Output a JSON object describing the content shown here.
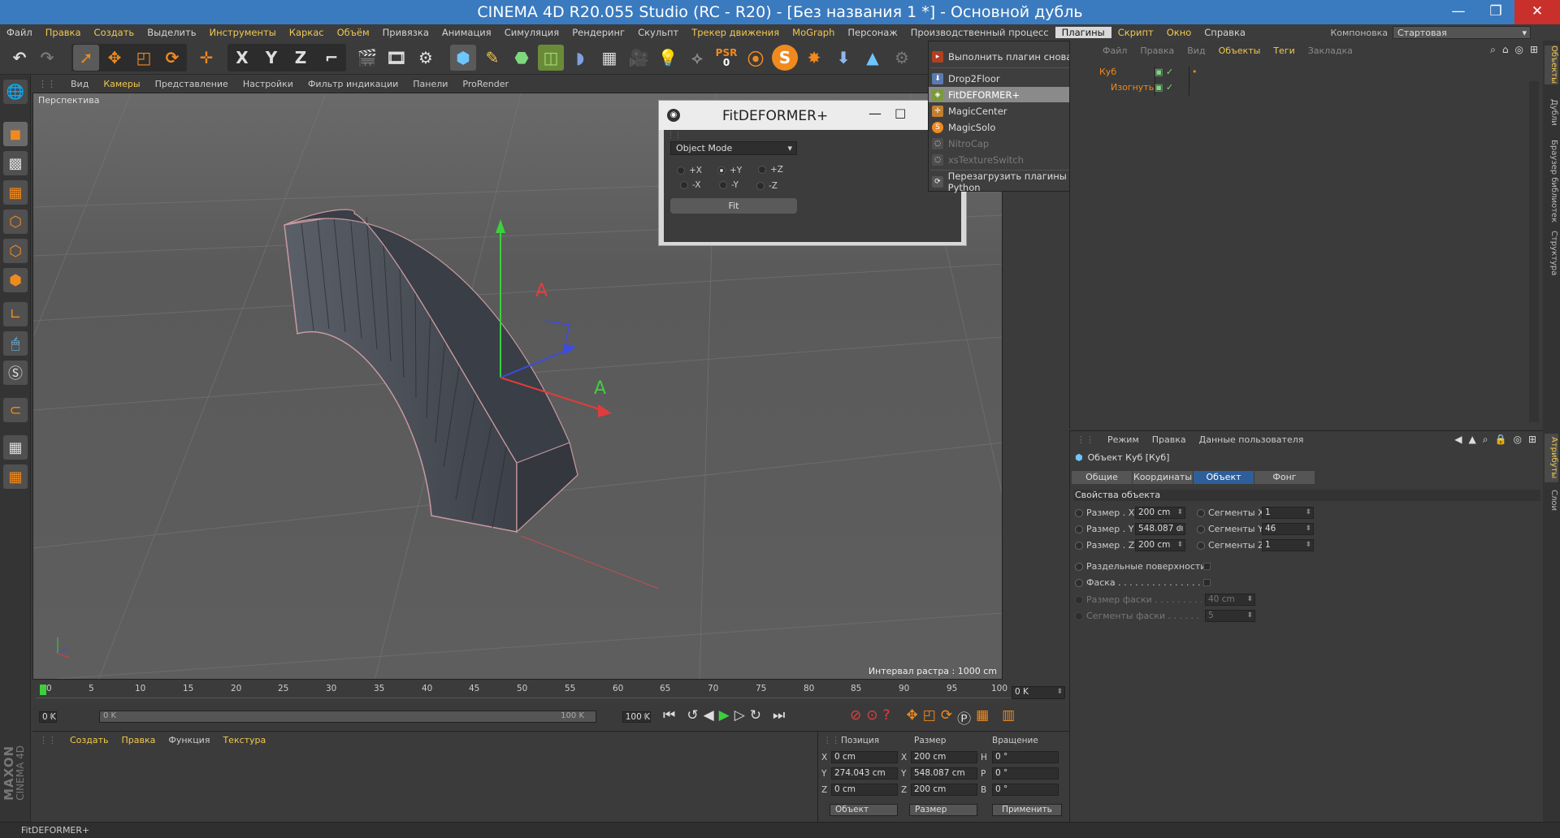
{
  "window": {
    "title": "CINEMA 4D R20.055 Studio (RC - R20) - [Без названия 1 *] - Основной дубль",
    "minimize": "—",
    "maximize": "❐",
    "close": "✕"
  },
  "menu": {
    "items": [
      "Файл",
      "Правка",
      "Создать",
      "Выделить",
      "Инструменты",
      "Каркас",
      "Объём",
      "Привязка",
      "Анимация",
      "Симуляция",
      "Рендеринг",
      "Скульпт",
      "Трекер движения",
      "MoGraph",
      "Персонаж",
      "Производственный процесс",
      "Плагины",
      "Скрипт",
      "Окно",
      "Справка"
    ],
    "layout_label": "Компоновка",
    "layout_value": "Стартовая (пользователь)"
  },
  "toolbar": {
    "x": "X",
    "y": "Y",
    "z": "Z",
    "psr": "PSR",
    "psr_value": "0",
    "s": "S"
  },
  "viewport": {
    "menu": [
      "Вид",
      "Камеры",
      "Представление",
      "Настройки",
      "Фильтр индикации",
      "Панели",
      "ProRender"
    ],
    "label": "Перспектива",
    "grid_info": "Интервал растра : 1000 cm"
  },
  "fitdeformer": {
    "title": "FitDEFORMER+",
    "mode": "Object Mode",
    "radios": [
      "+X",
      "+Y",
      "+Z",
      "-X",
      "-Y",
      "-Z"
    ],
    "fit_label": "Fit"
  },
  "plugins_menu": {
    "items": [
      "Выполнить плагин снова",
      "Drop2Floor",
      "FitDEFORMER+",
      "MagicCenter",
      "MagicSolo",
      "NitroCap",
      "xsTextureSwitch",
      "Перезагрузить плагины Python"
    ]
  },
  "object_manager": {
    "menu": [
      "Файл",
      "Правка",
      "Вид",
      "Объекты",
      "Теги",
      "Закладка"
    ],
    "objects": [
      "Куб",
      "Изогнуть"
    ]
  },
  "right_tabs": [
    "Объекты",
    "Дубли",
    "Браузер библиотек",
    "Структура",
    "Атрибуты",
    "Слои"
  ],
  "attributes": {
    "menu": [
      "Режим",
      "Правка",
      "Данные пользователя"
    ],
    "object_title": "Объект Куб [Куб]",
    "tabs": [
      "Общие",
      "Координаты",
      "Объект",
      "Фонг"
    ],
    "section": "Свойства объекта",
    "size_x_label": "Размер . X",
    "size_x": "200 cm",
    "size_y_label": "Размер . Y",
    "size_y": "548.087 cı",
    "size_z_label": "Размер . Z",
    "size_z": "200 cm",
    "seg_x_label": "Сегменты X",
    "seg_x": "1",
    "seg_y_label": "Сегменты Y",
    "seg_y": "46",
    "seg_z_label": "Сегменты Z",
    "seg_z": "1",
    "sep_surfaces": "Раздельные поверхности",
    "fillet": "Фаска . . . . . . . . . . . . . . . .",
    "fillet_size": "Размер фаски . . . . . . . . .",
    "fillet_size_val": "40 cm",
    "fillet_segs": "Сегменты фаски . . . . . . .",
    "fillet_segs_val": "5"
  },
  "timeline": {
    "ticks": [
      "0",
      "5",
      "10",
      "15",
      "20",
      "25",
      "30",
      "35",
      "40",
      "45",
      "50",
      "55",
      "60",
      "65",
      "70",
      "75",
      "80",
      "85",
      "90",
      "95",
      "100"
    ],
    "current": "0 K",
    "start": "0 K",
    "range_start": "0 K",
    "range_end": "100 K",
    "end": "100 K"
  },
  "materials": {
    "menu": [
      "Создать",
      "Правка",
      "Функция",
      "Текстура"
    ]
  },
  "coordinates": {
    "headers": [
      "Позиция",
      "Размер",
      "Вращение"
    ],
    "pos": [
      "0 cm",
      "274.043 cm",
      "0 cm"
    ],
    "size": [
      "200 cm",
      "548.087 cm",
      "200 cm"
    ],
    "rot": [
      "0 °",
      "0 °",
      "0 °"
    ],
    "axis_pos": [
      "X",
      "Y",
      "Z"
    ],
    "axis_rot": [
      "H",
      "P",
      "B"
    ],
    "mode1": "Объект",
    "mode2": "Размер",
    "apply": "Применить"
  },
  "status": {
    "text": "FitDEFORMER+",
    "logo_line1": "MAXON",
    "logo_line2": "CINEMA 4D"
  }
}
